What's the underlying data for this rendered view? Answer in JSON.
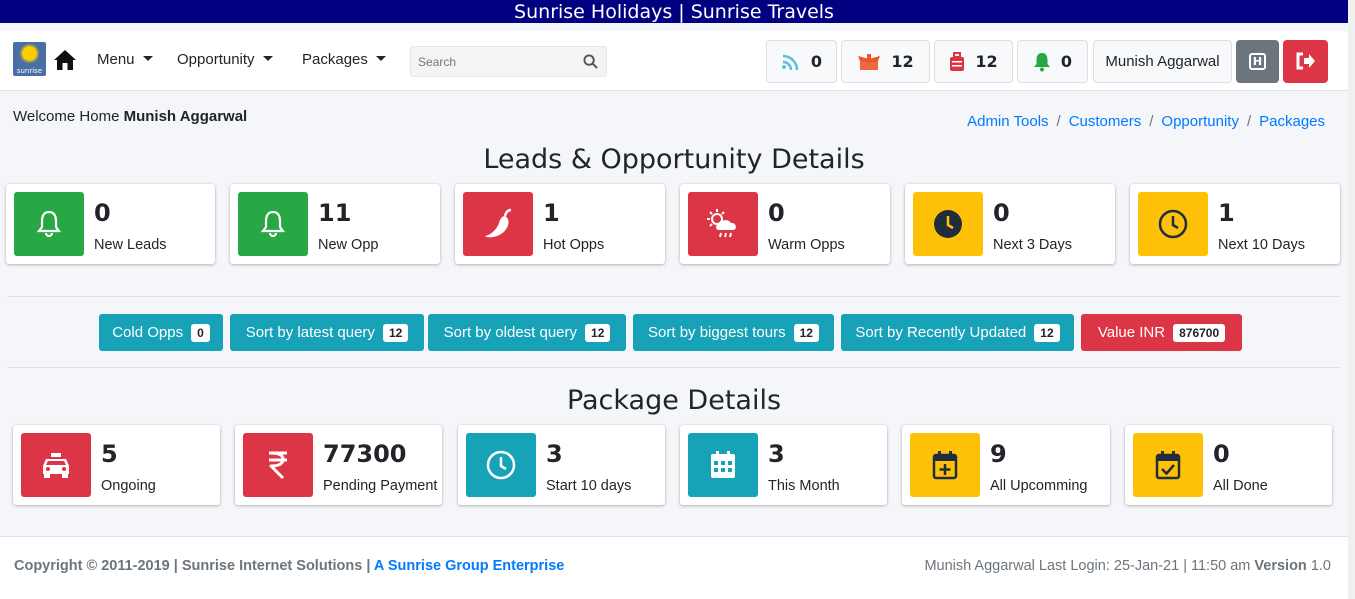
{
  "banner": "Sunrise Holidays | Sunrise Travels",
  "logo_text": "sunrise",
  "nav": {
    "menu": "Menu",
    "opportunity": "Opportunity",
    "packages": "Packages",
    "search_placeholder": "Search"
  },
  "counters": {
    "feed": "0",
    "boxes": "12",
    "bag": "12",
    "bell": "0"
  },
  "user_button": "Munish Aggarwal",
  "welcome": {
    "prefix": "Welcome Home",
    "name": "Munish Aggarwal"
  },
  "breadcrumb": [
    "Admin Tools",
    "Customers",
    "Opportunity",
    "Packages"
  ],
  "leads_title": "Leads & Opportunity Details",
  "leads_cards": [
    {
      "value": "0",
      "label": "New Leads",
      "icon": "bell-icon",
      "color": "#28a745"
    },
    {
      "value": "11",
      "label": "New Opp",
      "icon": "bell-icon",
      "color": "#28a745"
    },
    {
      "value": "1",
      "label": "Hot Opps",
      "icon": "pepper-icon",
      "color": "#dc3545"
    },
    {
      "value": "0",
      "label": "Warm Opps",
      "icon": "sun-cloud-rain-icon",
      "color": "#dc3545"
    },
    {
      "value": "0",
      "label": "Next 3 Days",
      "icon": "clock-solid-icon",
      "color": "#ffc107"
    },
    {
      "value": "1",
      "label": "Next 10 Days",
      "icon": "clock-outline-icon",
      "color": "#ffc107"
    }
  ],
  "sort_buttons": [
    {
      "label": "Cold Opps",
      "count": "0"
    },
    {
      "label": "Sort by latest query",
      "count": "12"
    },
    {
      "label": "Sort by oldest query",
      "count": "12"
    },
    {
      "label": "Sort by biggest tours",
      "count": "12"
    },
    {
      "label": "Sort by Recently Updated",
      "count": "12"
    },
    {
      "label": "Value INR",
      "count": "876700"
    }
  ],
  "package_title": "Package Details",
  "package_cards": [
    {
      "value": "5",
      "label": "Ongoing",
      "icon": "taxi-icon",
      "color": "#dc3545"
    },
    {
      "value": "77300",
      "label": "Pending Payment",
      "icon": "rupee-icon",
      "color": "#dc3545"
    },
    {
      "value": "3",
      "label": "Start 10 days",
      "icon": "clock-outline-icon",
      "color": "#17a2b8"
    },
    {
      "value": "3",
      "label": "This Month",
      "icon": "calendar-icon",
      "color": "#17a2b8"
    },
    {
      "value": "9",
      "label": "All Upcomming",
      "icon": "calendar-plus-icon",
      "color": "#ffc107"
    },
    {
      "value": "0",
      "label": "All Done",
      "icon": "calendar-check-icon",
      "color": "#ffc107"
    }
  ],
  "footer": {
    "copyright": "Copyright © 2011-2019 | Sunrise Internet Solutions |",
    "group_link": "A Sunrise Group Enterprise",
    "last_login": "Munish Aggarwal Last Login: 25-Jan-21 | 11:50 am",
    "version_label": "Version",
    "version": "1.0"
  }
}
